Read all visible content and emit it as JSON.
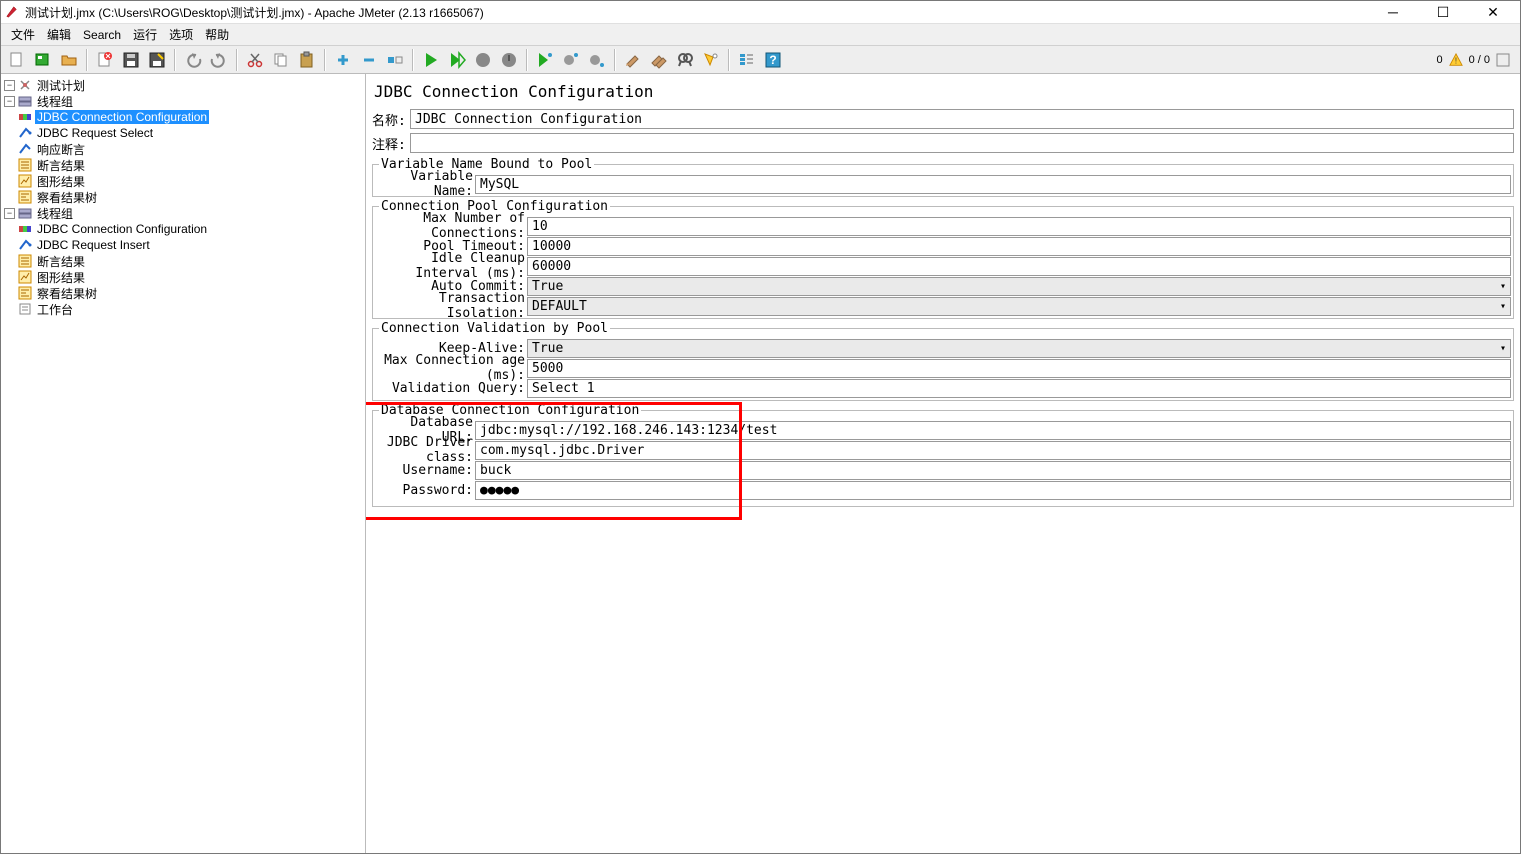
{
  "window": {
    "title": "测试计划.jmx (C:\\Users\\ROG\\Desktop\\测试计划.jmx) - Apache JMeter (2.13 r1665067)"
  },
  "menu": {
    "file": "文件",
    "edit": "编辑",
    "search": "Search",
    "run": "运行",
    "options": "选项",
    "help": "帮助"
  },
  "status": {
    "left_count": "0",
    "right_count": "0 / 0"
  },
  "tree": {
    "root": "测试计划",
    "tg1": "线程组",
    "tg1_items": {
      "jdbc_conn": "JDBC Connection Configuration",
      "jdbc_req_sel": "JDBC Request Select",
      "resp_assert": "响应断言",
      "assert_result": "断言结果",
      "graph_result": "图形结果",
      "view_tree": "察看结果树"
    },
    "tg2": "线程组",
    "tg2_items": {
      "jdbc_conn": "JDBC Connection Configuration",
      "jdbc_req_ins": "JDBC Request Insert",
      "assert_result": "断言结果",
      "graph_result": "图形结果",
      "view_tree": "察看结果树"
    },
    "workbench": "工作台"
  },
  "panel": {
    "title": "JDBC Connection Configuration",
    "name_label": "名称:",
    "name_value": "JDBC Connection Configuration",
    "comment_label": "注释:",
    "comment_value": "",
    "varpool": {
      "legend": "Variable Name Bound to Pool",
      "var_name_label": "Variable Name:",
      "var_name_value": "MySQL"
    },
    "connpool": {
      "legend": "Connection Pool Configuration",
      "max_conn_label": "Max Number of Connections:",
      "max_conn_value": "10",
      "pool_timeout_label": "Pool Timeout:",
      "pool_timeout_value": "10000",
      "idle_label": "Idle Cleanup Interval (ms):",
      "idle_value": "60000",
      "auto_commit_label": "Auto Commit:",
      "auto_commit_value": "True",
      "tx_iso_label": "Transaction Isolation:",
      "tx_iso_value": "DEFAULT"
    },
    "validation": {
      "legend": "Connection Validation by Pool",
      "keep_alive_label": "Keep-Alive:",
      "keep_alive_value": "True",
      "max_age_label": "Max Connection age (ms):",
      "max_age_value": "5000",
      "val_query_label": "Validation Query:",
      "val_query_value": "Select 1"
    },
    "dbconn": {
      "legend": "Database Connection Configuration",
      "url_label": "Database URL:",
      "url_value": "jdbc:mysql://192.168.246.143:1234/test",
      "driver_label": "JDBC Driver class:",
      "driver_value": "com.mysql.jdbc.Driver",
      "user_label": "Username:",
      "user_value": "buck",
      "pass_label": "Password:",
      "pass_value": "●●●●●"
    }
  }
}
